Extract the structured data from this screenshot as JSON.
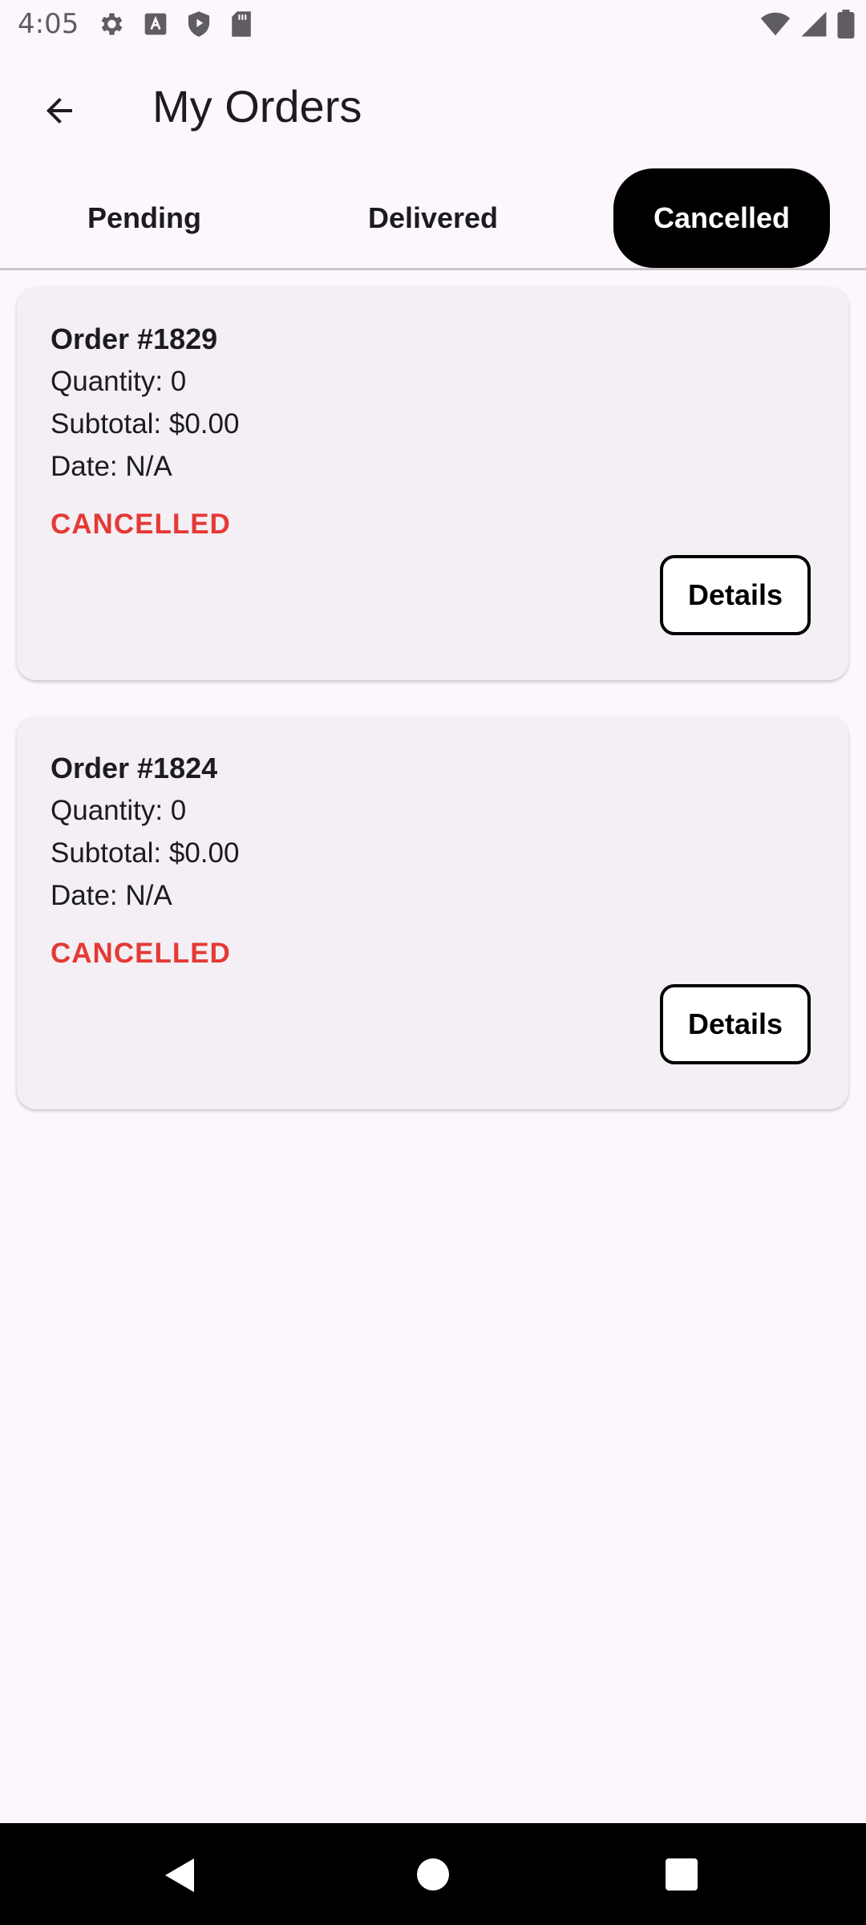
{
  "status_bar": {
    "time": "4:05",
    "icons_left": [
      "gear-icon",
      "text-a-icon",
      "shield-icon",
      "sd-card-icon"
    ],
    "icons_right": [
      "wifi-icon",
      "cell-signal-icon",
      "battery-icon"
    ]
  },
  "header": {
    "title": "My Orders",
    "back_icon": "arrow-left-icon"
  },
  "tabs": [
    {
      "label": "Pending",
      "selected": false
    },
    {
      "label": "Delivered",
      "selected": false
    },
    {
      "label": "Cancelled",
      "selected": true
    }
  ],
  "orders": [
    {
      "title": "Order #1829",
      "quantity": "Quantity: 0",
      "subtotal": "Subtotal: $0.00",
      "date": "Date: N/A",
      "status": "CANCELLED",
      "button_label": "Details"
    },
    {
      "title": "Order #1824",
      "quantity": "Quantity: 0",
      "subtotal": "Subtotal: $0.00",
      "date": "Date: N/A",
      "status": "CANCELLED",
      "button_label": "Details"
    }
  ],
  "colors": {
    "background": "#fdf7fd",
    "card": "#f3eff4",
    "status_cancelled": "#e53935",
    "tab_selected_bg": "#000000",
    "tab_selected_text": "#ffffff"
  },
  "nav_bar": {
    "icons": [
      "nav-back-icon",
      "nav-home-icon",
      "nav-recents-icon"
    ]
  }
}
